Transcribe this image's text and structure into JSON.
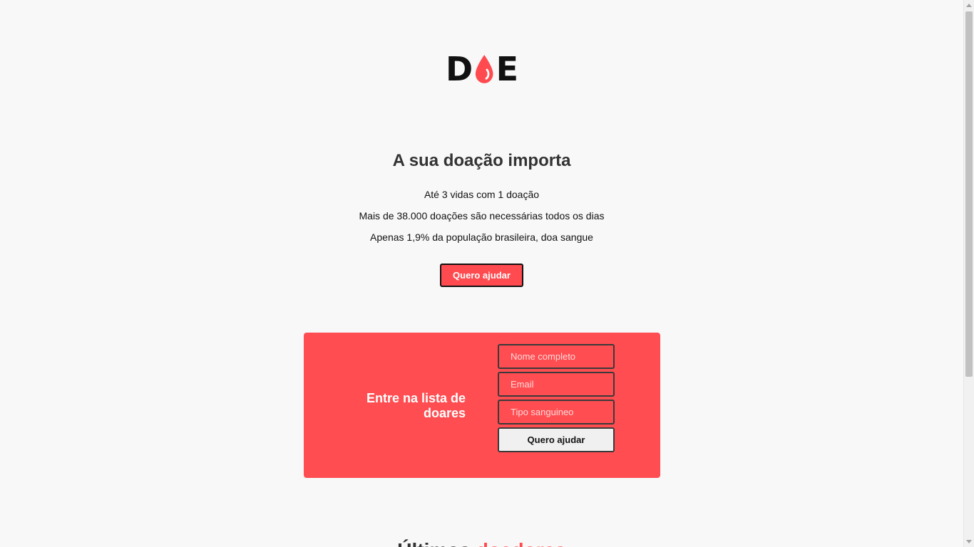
{
  "logo": {
    "letter_left": "D",
    "letter_right": "E",
    "drop_color": "#ff4a4f",
    "drop_icon": "blood-drop-icon"
  },
  "hero": {
    "title": "A sua doação importa",
    "facts": [
      "Até 3 vidas com 1 doação",
      "Mais de 38.000 doações são necessárias todos os dias",
      "Apenas 1,9% da população brasileira, doa sangue"
    ],
    "button_label": "Quero ajudar"
  },
  "signup": {
    "title": "Entre na lista de doares",
    "name_placeholder": "Nome completo",
    "email_placeholder": "Email",
    "blood_placeholder": "Tipo sanguineo",
    "submit_label": "Quero ajudar",
    "card_color": "#ff4d51"
  },
  "donors": {
    "heading_dark": "Últimos",
    "heading_accent": "doadores"
  },
  "colors": {
    "accent": "#ff4a4f",
    "background": "#f8f8f8"
  }
}
